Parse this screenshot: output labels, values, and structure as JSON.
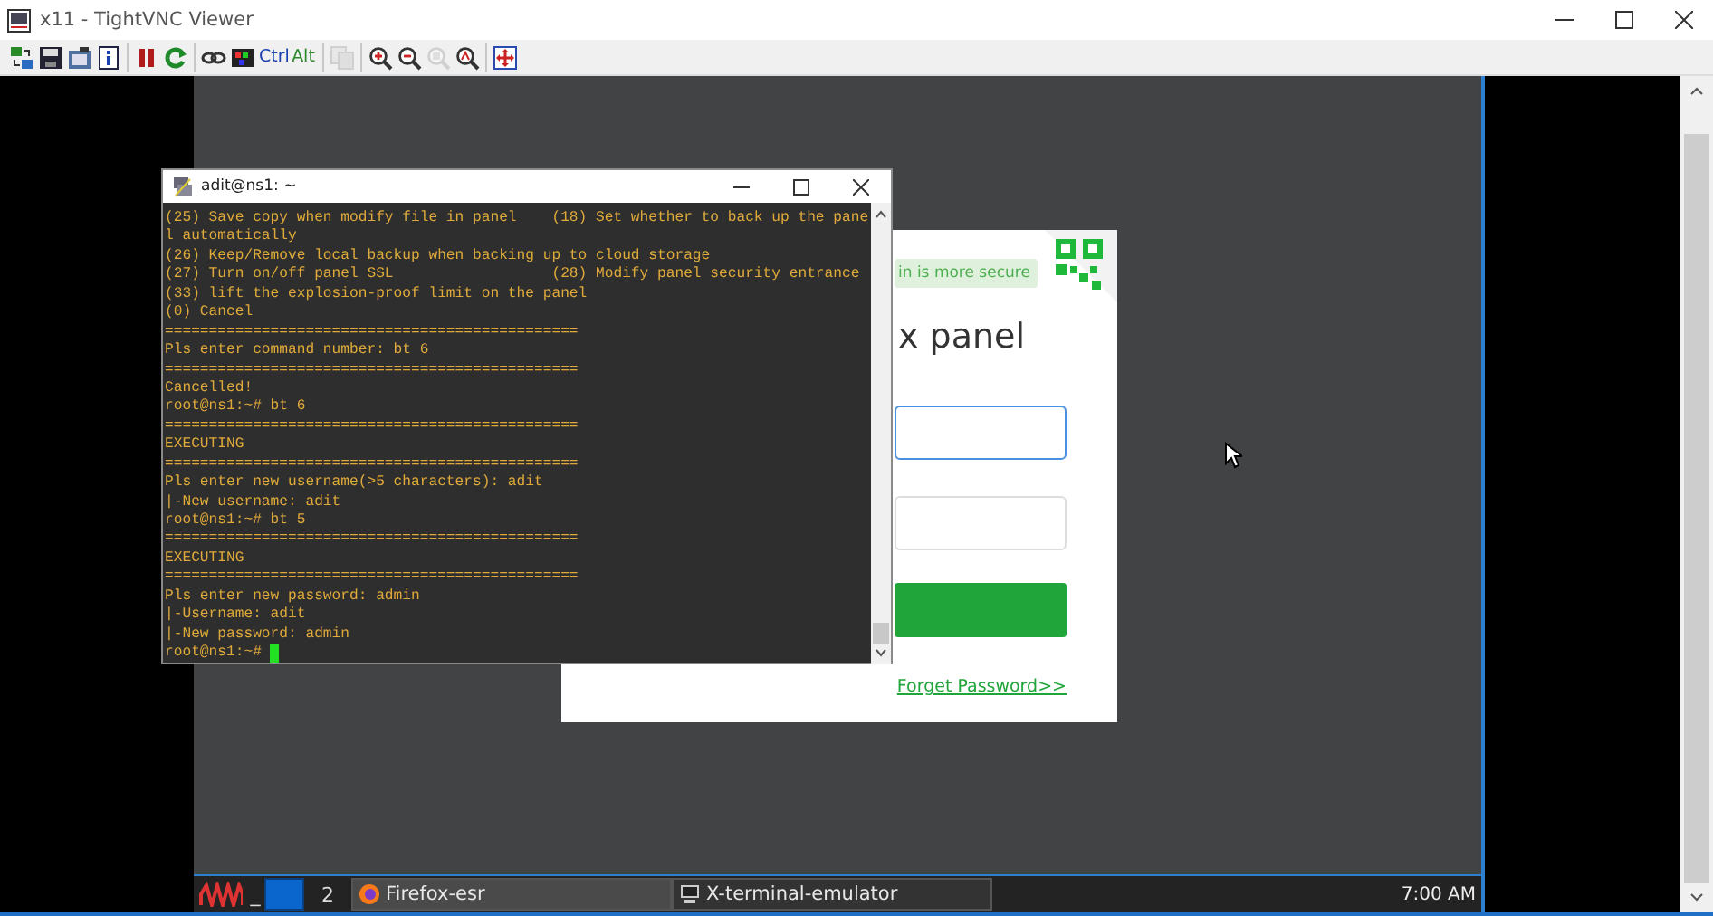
{
  "viewer_window": {
    "title": "x11 - TightVNC Viewer"
  },
  "toolbar_groups": [
    [
      {
        "kind": "icon",
        "disabled": false
      },
      {
        "kind": "icon",
        "disabled": false
      },
      {
        "kind": "icon",
        "disabled": false
      },
      {
        "kind": "icon",
        "disabled": false
      }
    ],
    [
      {
        "kind": "icon",
        "disabled": false
      },
      {
        "kind": "icon",
        "disabled": false
      }
    ],
    [
      {
        "kind": "icon",
        "disabled": false
      },
      {
        "kind": "icon",
        "disabled": false
      },
      {
        "kind": "text",
        "label": "Ctrl",
        "disabled": false
      },
      {
        "kind": "text",
        "label": "Alt",
        "disabled": false
      }
    ],
    [
      {
        "kind": "icon",
        "disabled": true
      }
    ],
    [
      {
        "kind": "icon",
        "disabled": false
      },
      {
        "kind": "icon",
        "disabled": false
      },
      {
        "kind": "icon",
        "disabled": true
      },
      {
        "kind": "icon",
        "disabled": false
      }
    ],
    [
      {
        "kind": "icon",
        "disabled": false
      }
    ]
  ],
  "login_card": {
    "hint": "in is more secure",
    "title": "x panel",
    "link": "Forget Password>>"
  },
  "terminal": {
    "title": "adit@ns1: ~",
    "lines": [
      "(25) Save copy when modify file in panel    (18) Set whether to back up the pane",
      "l automatically",
      "(26) Keep/Remove local backup when backing up to cloud storage",
      "(27) Turn on/off panel SSL                  (28) Modify panel security entrance",
      "(33) lift the explosion-proof limit on the panel",
      "(0) Cancel",
      "===============================================",
      "Pls enter command number: bt 6",
      "===============================================",
      "Cancelled!",
      "root@ns1:~# bt 6",
      "===============================================",
      "EXECUTING",
      "===============================================",
      "Pls enter new username(>5 characters): adit",
      "|-New username: adit",
      "root@ns1:~# bt 5",
      "===============================================",
      "EXECUTING",
      "===============================================",
      "Pls enter new password: admin",
      "|-Username: adit",
      "|-New password: admin",
      "root@ns1:~# "
    ]
  },
  "taskbar": {
    "desktop_button": "_",
    "workspaces": [
      {
        "selected": true
      },
      {
        "label": "2",
        "selected": false
      }
    ],
    "tasks": [
      {
        "label": "Firefox-esr",
        "selected": true
      },
      {
        "label": "X-terminal-emulator",
        "selected": false
      }
    ],
    "clock": "7:00 AM"
  }
}
